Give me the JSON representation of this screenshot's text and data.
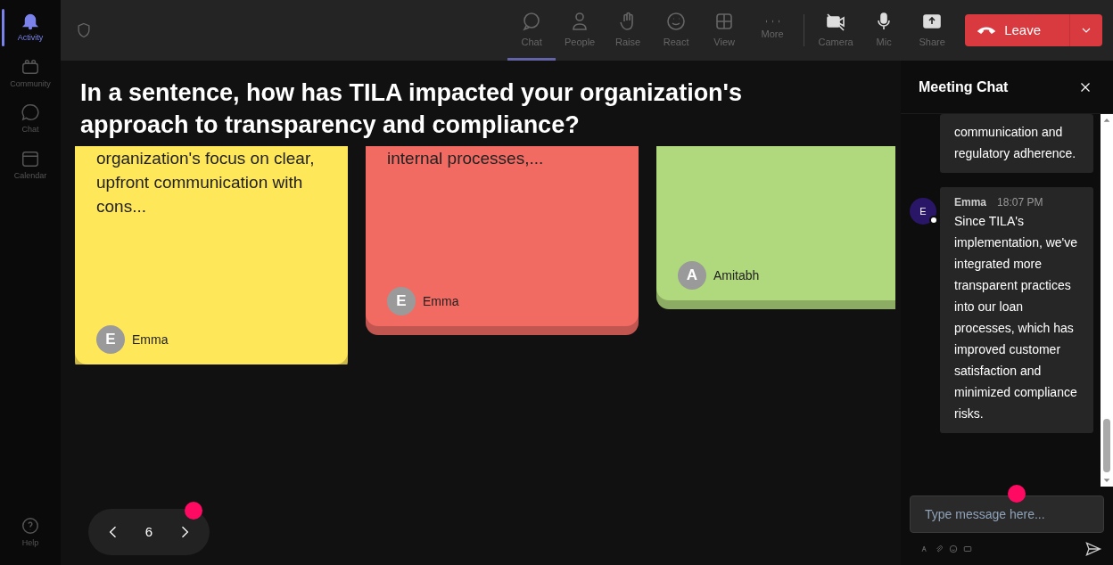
{
  "sidebar": {
    "items": [
      {
        "label": "Activity",
        "selected": true
      },
      {
        "label": "Community",
        "selected": false
      },
      {
        "label": "Chat",
        "selected": false
      },
      {
        "label": "Calendar",
        "selected": false
      }
    ],
    "help": {
      "label": "Help"
    }
  },
  "toolbar": {
    "items": [
      {
        "label": "Chat",
        "selected": true
      },
      {
        "label": "People",
        "selected": false
      },
      {
        "label": "Raise",
        "selected": false
      },
      {
        "label": "React",
        "selected": false
      },
      {
        "label": "View",
        "selected": false
      },
      {
        "label": "More",
        "selected": false
      },
      {
        "label": "Camera",
        "selected": false
      },
      {
        "label": "Mic",
        "selected": false
      },
      {
        "label": "Share",
        "selected": false
      }
    ],
    "leave": {
      "label": "Leave"
    }
  },
  "question": "In a sentence, how has TILA impacted your organization's approach to transparency and compliance?",
  "cards": [
    {
      "color": "#ffe75a",
      "text": "organization's focus on clear, upfront communication with cons...",
      "initial": "E",
      "author": "Emma"
    },
    {
      "color": "#f26b63",
      "text": "internal processes,...",
      "initial": "E",
      "author": "Emma"
    },
    {
      "color": "#b0d87c",
      "initial": "A",
      "author": "Amitabh"
    }
  ],
  "pager": {
    "page": "6"
  },
  "chat": {
    "title": "Meeting Chat",
    "messages": [
      {
        "text": "communication and regulatory adherence."
      },
      {
        "initial": "E",
        "author": "Emma",
        "time": "18:07 PM",
        "text": "Since TILA's implementation, we've integrated more transparent practices into our loan processes, which has improved customer satisfaction and minimized compliance risks."
      }
    ],
    "input": {
      "placeholder": "Type message here..."
    }
  }
}
